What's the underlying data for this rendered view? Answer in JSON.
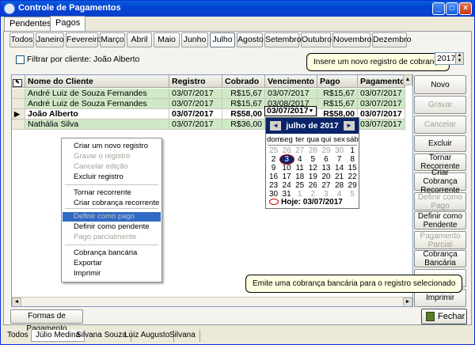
{
  "window": {
    "title": "Controle de Pagamentos"
  },
  "top_tabs": [
    {
      "label": "Pendentes",
      "active": false
    },
    {
      "label": "Pagos",
      "active": true
    }
  ],
  "months": [
    "Todos",
    "Janeiro",
    "Fevereiro",
    "Março",
    "Abril",
    "Maio",
    "Junho",
    "Julho",
    "Agosto",
    "Setembro",
    "Outubro",
    "Novembro",
    "Dezembro"
  ],
  "active_month": "Julho",
  "filter": {
    "label": "Filtrar por cliente: João Alberto",
    "checked": false
  },
  "year": {
    "value": "2017"
  },
  "tooltip_top": "Insere um novo registro de cobrança",
  "tooltip_bottom": "Emite uma cobrança bancária para o registro selecionado",
  "grid": {
    "columns": [
      "Nome do Cliente",
      "Registro",
      "Cobrado",
      "Vencimento",
      "Pago",
      "Pagamento"
    ],
    "rows": [
      {
        "nome": "André Luiz de Souza Fernandes",
        "registro": "03/07/2017",
        "cobrado": "R$15,67",
        "vencimento": "03/07/2017",
        "pago": "R$15,67",
        "pagamento": "03/07/2017",
        "style": "green"
      },
      {
        "nome": "André Luiz de Souza Fernandes",
        "registro": "03/07/2017",
        "cobrado": "R$15,67",
        "vencimento": "03/08/2017",
        "pago": "R$15,67",
        "pagamento": "03/07/2017",
        "style": "green"
      },
      {
        "nome": "João Alberto",
        "registro": "03/07/2017",
        "cobrado": "R$58,00",
        "vencimento": "03/07/2017",
        "pago": "R$58,00",
        "pagamento": "03/07/2017",
        "style": "sel"
      },
      {
        "nome": "Nathália Silva",
        "registro": "03/07/2017",
        "cobrado": "R$36,00",
        "vencimento": "",
        "pago": "00",
        "pagamento": "03/07/2017",
        "style": "green"
      }
    ]
  },
  "right_buttons": [
    {
      "label": "Novo",
      "enabled": true
    },
    {
      "label": "Gravar",
      "enabled": false
    },
    {
      "label": "Cancelar",
      "enabled": false
    },
    {
      "label": "Excluir",
      "enabled": true
    },
    {
      "label": "Tornar Recorrente",
      "enabled": true
    },
    {
      "label": "Criar Cobrança Recorrente",
      "enabled": true
    },
    {
      "label": "Definir como Pago",
      "enabled": false
    },
    {
      "label": "Definir como Pendente",
      "enabled": true
    },
    {
      "label": "Pagamento Parcial",
      "enabled": false
    },
    {
      "label": "Cobrança Bancária",
      "enabled": true
    },
    {
      "label": "Exportar",
      "enabled": true
    },
    {
      "label": "Imprimir",
      "enabled": true
    }
  ],
  "context_menu": {
    "items": [
      {
        "label": "Criar um novo registro",
        "state": "enabled"
      },
      {
        "label": "Gravar o registro",
        "state": "disabled"
      },
      {
        "label": "Cancelar edição",
        "state": "disabled"
      },
      {
        "label": "Excluir registro",
        "state": "enabled"
      },
      {
        "label": "Tornar recorrente",
        "state": "enabled"
      },
      {
        "label": "Criar cobrança recorrente",
        "state": "enabled"
      },
      {
        "label": "Definir como pago",
        "state": "highlighted"
      },
      {
        "label": "Definir como pendente",
        "state": "enabled"
      },
      {
        "label": "Pago parcialmente",
        "state": "disabled"
      },
      {
        "label": "Cobrança bancária",
        "state": "enabled"
      },
      {
        "label": "Exportar",
        "state": "enabled"
      },
      {
        "label": "Imprimir",
        "state": "enabled"
      }
    ]
  },
  "date_dropdown": {
    "value": "03/07/2017"
  },
  "calendar": {
    "month_label": "julho de 2017",
    "weekdays": [
      "dom",
      "seg",
      "ter",
      "qua",
      "qui",
      "sex",
      "sáb"
    ],
    "weeks": [
      [
        "25",
        "26",
        "27",
        "28",
        "29",
        "30",
        "1"
      ],
      [
        "2",
        "3",
        "4",
        "5",
        "6",
        "7",
        "8"
      ],
      [
        "9",
        "10",
        "11",
        "12",
        "13",
        "14",
        "15"
      ],
      [
        "16",
        "17",
        "18",
        "19",
        "20",
        "21",
        "22"
      ],
      [
        "23",
        "24",
        "25",
        "26",
        "27",
        "28",
        "29"
      ],
      [
        "30",
        "31",
        "1",
        "2",
        "3",
        "4",
        "5"
      ]
    ],
    "selected_day": "3",
    "today_label": "Hoje: 03/07/2017"
  },
  "bottom": {
    "formas_label": "Formas de Pagamento",
    "fechar_label": "Fechar"
  },
  "bottom_tabs": [
    {
      "label": "Todos",
      "active": false
    },
    {
      "label": "Júlio Medina",
      "active": true
    },
    {
      "label": "Silvana Souza",
      "active": false
    },
    {
      "label": "Luiz Augusto",
      "active": false
    },
    {
      "label": "Silvana",
      "active": false
    }
  ]
}
